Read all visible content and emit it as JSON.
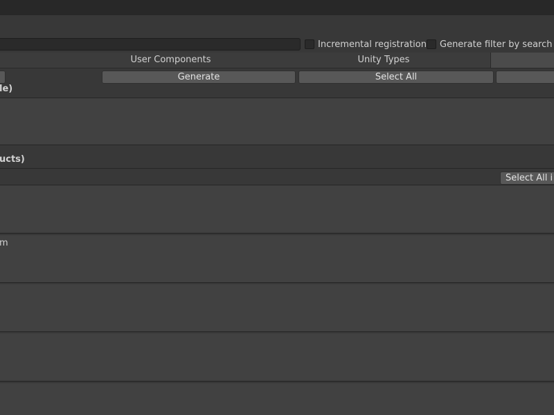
{
  "toolbar": {
    "search_value": "",
    "incremental_registration_label": "Incremental registration",
    "generate_filter_label": "Generate filter by search"
  },
  "tabs": [
    {
      "label": ""
    },
    {
      "label": "User Components"
    },
    {
      "label": "Unity Types"
    },
    {
      "label": ""
    }
  ],
  "buttons": {
    "generate": "Generate",
    "select_all": "Select All",
    "select_all_in": "Select All i"
  },
  "sections": {
    "first_header": "le)",
    "second_header": "ucts)",
    "item_text": "m"
  }
}
